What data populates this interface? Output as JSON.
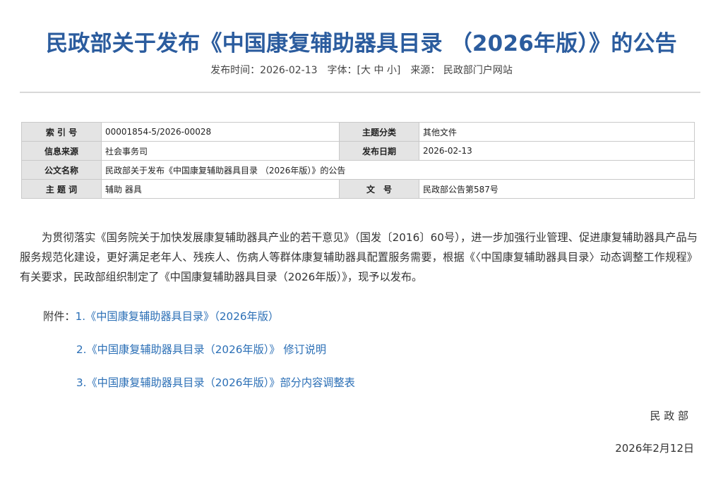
{
  "title": "民政部关于发布《中国康复辅助器具目录 （2026年版）》的公告",
  "meta": {
    "date_label": "发布时间：",
    "date": "2026-02-13",
    "font_label": "字体：",
    "font_open": "[",
    "font_large": "大",
    "font_medium": "中",
    "font_small": "小",
    "font_close": "]",
    "source_label": "来源：",
    "source": "民政部门户网站"
  },
  "info_table": {
    "index_label": "索 引 号",
    "index_value": "00001854-5/2026-00028",
    "category_label": "主题分类",
    "category_value": "其他文件",
    "origin_label": "信息来源",
    "origin_value": "社会事务司",
    "pubdate_label": "发布日期",
    "pubdate_value": "2026-02-13",
    "doc_name_label": "公文名称",
    "doc_name_value": "民政部关于发布《中国康复辅助器具目录 （2026年版）》的公告",
    "keywords_label": "主 题 词",
    "keywords_value": "辅助 器具",
    "doc_no_label": "文　号",
    "doc_no_value": "民政部公告第587号"
  },
  "body": {
    "paragraph": "为贯彻落实《国务院关于加快发展康复辅助器具产业的若干意见》（国发〔2016〕60号），进一步加强行业管理、促进康复辅助器具产品与服务规范化建设，更好满足老年人、残疾人、伤病人等群体康复辅助器具配置服务需要，根据《〈中国康复辅助器具目录〉动态调整工作规程》有关要求，民政部组织制定了《中国康复辅助器具目录（2026年版）》，现予以发布。"
  },
  "attachments": {
    "prefix": "附件：",
    "items": [
      "1.《中国康复辅助器具目录》（2026年版）",
      "2.《中国康复辅助器具目录（2026年版）》 修订说明",
      "3.《中国康复辅助器具目录（2026年版）》部分内容调整表"
    ]
  },
  "signature": {
    "issuer": "民 政 部",
    "date": "2026年2月12日"
  },
  "colors": {
    "title": "#2b5c9e",
    "link": "#2b6fb6",
    "label_bg": "#e4e4e4",
    "border": "#c9c9c9"
  }
}
